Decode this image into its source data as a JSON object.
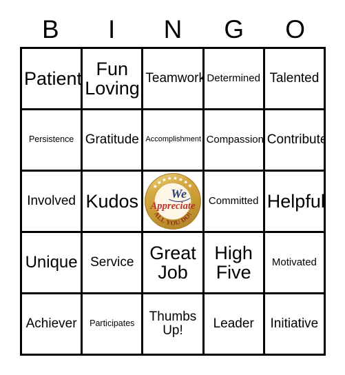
{
  "card": {
    "title_letters": [
      "B",
      "I",
      "N",
      "G",
      "O"
    ],
    "background_color": "#ffffff",
    "grid_line_color": "#000000",
    "text_color": "#000000"
  },
  "grid": {
    "columns": 5,
    "rows": 5,
    "cells": [
      {
        "text": "Patient",
        "size": "xl",
        "column": "B",
        "row": 1
      },
      {
        "text": "Fun Loving",
        "size": "xl",
        "column": "I",
        "row": 1
      },
      {
        "text": "Teamwork",
        "size": "md",
        "column": "N",
        "row": 1
      },
      {
        "text": "Determined",
        "size": "sm",
        "column": "G",
        "row": 1
      },
      {
        "text": "Talented",
        "size": "md",
        "column": "O",
        "row": 1
      },
      {
        "text": "Persistence",
        "size": "xs",
        "column": "B",
        "row": 2
      },
      {
        "text": "Gratitude",
        "size": "md",
        "column": "I",
        "row": 2
      },
      {
        "text": "Accomplishment",
        "size": "xxs",
        "column": "N",
        "row": 2
      },
      {
        "text": "Compassion",
        "size": "sm",
        "column": "G",
        "row": 2
      },
      {
        "text": "Contribute",
        "size": "md",
        "column": "O",
        "row": 2
      },
      {
        "text": "Involved",
        "size": "md",
        "column": "B",
        "row": 3
      },
      {
        "text": "Kudos",
        "size": "xl",
        "column": "I",
        "row": 3
      },
      {
        "text": "",
        "size": "md",
        "column": "N",
        "row": 3,
        "free_space": true
      },
      {
        "text": "Committed",
        "size": "sm",
        "column": "G",
        "row": 3
      },
      {
        "text": "Helpful",
        "size": "xl",
        "column": "O",
        "row": 3
      },
      {
        "text": "Unique",
        "size": "lg",
        "column": "B",
        "row": 4
      },
      {
        "text": "Service",
        "size": "md",
        "column": "I",
        "row": 4
      },
      {
        "text": "Great Job",
        "size": "xl",
        "column": "N",
        "row": 4
      },
      {
        "text": "High Five",
        "size": "xl",
        "column": "G",
        "row": 4
      },
      {
        "text": "Motivated",
        "size": "sm",
        "column": "O",
        "row": 4
      },
      {
        "text": "Achiever",
        "size": "md",
        "column": "B",
        "row": 5
      },
      {
        "text": "Participates",
        "size": "xs",
        "column": "I",
        "row": 5
      },
      {
        "text": "Thumbs Up!",
        "size": "md",
        "column": "N",
        "row": 5
      },
      {
        "text": "Leader",
        "size": "md",
        "column": "G",
        "row": 5
      },
      {
        "text": "Initiative",
        "size": "md",
        "column": "O",
        "row": 5
      }
    ]
  },
  "free_space": {
    "name": "we-appreciate-badge",
    "word_we": "We",
    "word_appreciate": "Appreciate",
    "word_bottom": "ALL YOU DO!",
    "ring_color": "#d4a843",
    "ring_inner_color": "#c79a33",
    "star_color": "#ffffff",
    "we_color": "#2b3f7a",
    "appreciate_color": "#b8352a",
    "bottom_text_color": "#8b2f1f",
    "center_color": "#fdf6e6"
  }
}
